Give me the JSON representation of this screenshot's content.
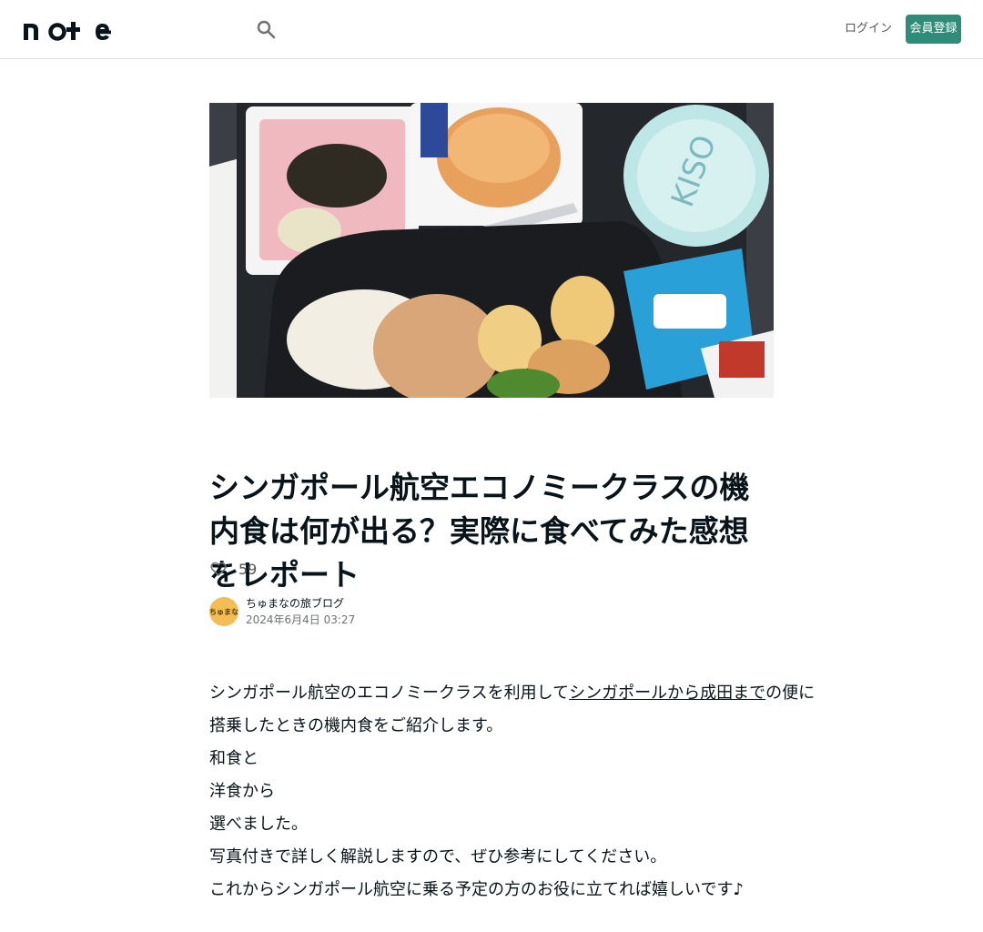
{
  "header": {
    "logo_text": "note",
    "search_icon": "search-icon",
    "login_label": "ログイン",
    "signup_label": "会員登録",
    "accent_color": "#2f8c78"
  },
  "hero": {
    "icon": "in-flight-meal-photo"
  },
  "article": {
    "title": "シンガポール航空エコノミークラスの機内食は何が出る？実際に食べてみた感想をレポート",
    "like_count": "59",
    "author_name": "ちゅまなの旅ブログ",
    "avatar_text": "ちゅまな",
    "date": "2024年6月4日 03:27",
    "paragraphs": [
      {
        "before": "シンガポール航空のエコノミークラスを利用して",
        "link": "シンガポールから成田まで",
        "after": "の便に"
      },
      {
        "text": "搭乗したときの機内食をご紹介します。"
      },
      {
        "text": "和食と"
      },
      {
        "text": "洋食から"
      },
      {
        "text": "選べました。"
      },
      {
        "text": "写真付きで詳しく解説しますので、ぜひ参考にしてください。"
      },
      {
        "text": "これからシンガポール航空に乗る予定の方のお役に立てれば嬉しいです♪"
      }
    ]
  }
}
